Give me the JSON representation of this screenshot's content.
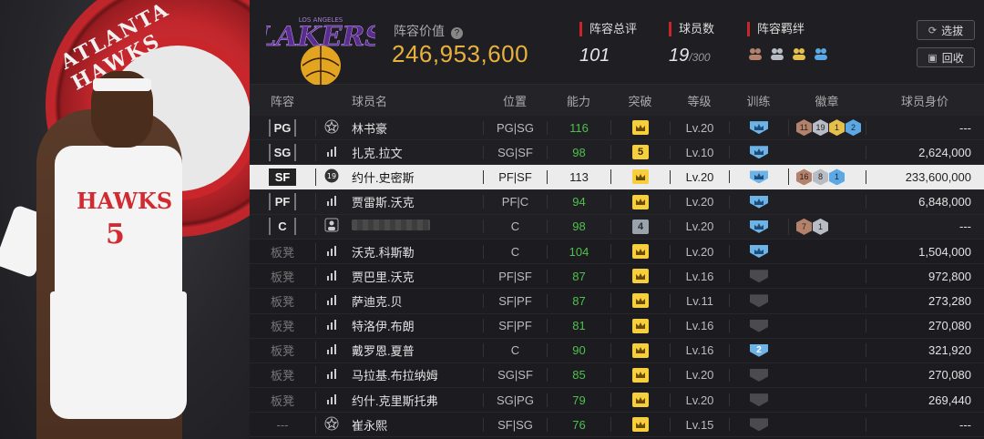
{
  "header": {
    "value_label": "阵容价值",
    "value": "246,953,600",
    "team_logo_text": "LAKERS",
    "team_logo_city": "LOS ANGELES",
    "stats": [
      {
        "label": "阵容总评",
        "value": "101"
      },
      {
        "label": "球员数",
        "value": "19",
        "suffix": "/300"
      },
      {
        "label": "阵容羁绊"
      }
    ],
    "buttons": {
      "pick": "选拔",
      "recycle": "回收"
    }
  },
  "left_panel": {
    "logo_text": "ATLANTA HAWKS",
    "jersey_name": "HAWKS",
    "jersey_number": "5"
  },
  "columns": {
    "lineup": "阵容",
    "player_name": "球员名",
    "position": "位置",
    "ability": "能力",
    "breakthrough": "突破",
    "level": "等级",
    "training": "训练",
    "badge": "徽章",
    "value": "球员身价"
  },
  "rows": [
    {
      "slot": "PG",
      "name": "林书豪",
      "position": "PG|SG",
      "ability": "116",
      "breakthrough": "crown",
      "level": "Lv.20",
      "training": "blue",
      "badges": [
        {
          "t": "bronze",
          "n": "11"
        },
        {
          "t": "silver",
          "n": "19"
        },
        {
          "t": "gold",
          "n": "1"
        },
        {
          "t": "blue",
          "n": "2"
        }
      ],
      "value": "---",
      "icon": "star"
    },
    {
      "slot": "SG",
      "name": "扎克.拉文",
      "position": "SG|SF",
      "ability": "98",
      "breakthrough": "5",
      "level": "Lv.10",
      "training": "blue",
      "badges": [],
      "value": "2,624,000",
      "icon": "bars"
    },
    {
      "slot": "SF",
      "name": "约什.史密斯",
      "position": "PF|SF",
      "ability": "113",
      "breakthrough": "crown",
      "level": "Lv.20",
      "training": "blue",
      "badges": [
        {
          "t": "bronze",
          "n": "16"
        },
        {
          "t": "silver",
          "n": "8"
        },
        {
          "t": "blue",
          "n": "1"
        }
      ],
      "value": "233,600,000",
      "icon": "rank19",
      "selected": true
    },
    {
      "slot": "PF",
      "name": "贾雷斯.沃克",
      "position": "PF|C",
      "ability": "94",
      "breakthrough": "crown",
      "level": "Lv.20",
      "training": "blue",
      "badges": [],
      "value": "6,848,000",
      "icon": "bars"
    },
    {
      "slot": "C",
      "name": "",
      "position": "C",
      "ability": "98",
      "breakthrough": "4",
      "level": "Lv.20",
      "training": "blue",
      "badges": [
        {
          "t": "bronze",
          "n": "7"
        },
        {
          "t": "silver",
          "n": "1"
        }
      ],
      "value": "---",
      "icon": "person",
      "blurred": true
    },
    {
      "slot": "板凳",
      "name": "沃克.科斯勒",
      "position": "C",
      "ability": "104",
      "breakthrough": "crown",
      "level": "Lv.20",
      "training": "blue",
      "badges": [],
      "value": "1,504,000",
      "icon": "bars"
    },
    {
      "slot": "板凳",
      "name": "贾巴里.沃克",
      "position": "PF|SF",
      "ability": "87",
      "breakthrough": "crown",
      "level": "Lv.16",
      "training": "grey",
      "badges": [],
      "value": "972,800",
      "icon": "bars"
    },
    {
      "slot": "板凳",
      "name": "萨迪克.贝",
      "position": "SF|PF",
      "ability": "87",
      "breakthrough": "crown",
      "level": "Lv.11",
      "training": "grey",
      "badges": [],
      "value": "273,280",
      "icon": "bars"
    },
    {
      "slot": "板凳",
      "name": "特洛伊.布朗",
      "position": "SF|PF",
      "ability": "81",
      "breakthrough": "crown",
      "level": "Lv.16",
      "training": "grey",
      "badges": [],
      "value": "270,080",
      "icon": "bars"
    },
    {
      "slot": "板凳",
      "name": "戴罗恩.夏普",
      "position": "C",
      "ability": "90",
      "breakthrough": "crown",
      "level": "Lv.16",
      "training": "blue2",
      "badges": [],
      "value": "321,920",
      "icon": "bars"
    },
    {
      "slot": "板凳",
      "name": "马拉基.布拉纳姆",
      "position": "SG|SF",
      "ability": "85",
      "breakthrough": "crown",
      "level": "Lv.20",
      "training": "grey",
      "badges": [],
      "value": "270,080",
      "icon": "bars"
    },
    {
      "slot": "板凳",
      "name": "约什.克里斯托弗",
      "position": "SG|PG",
      "ability": "79",
      "breakthrough": "crown",
      "level": "Lv.20",
      "training": "grey",
      "badges": [],
      "value": "269,440",
      "icon": "bars"
    },
    {
      "slot": "---",
      "name": "崔永熙",
      "position": "SF|SG",
      "ability": "76",
      "breakthrough": "crown",
      "level": "Lv.15",
      "training": "grey",
      "badges": [],
      "value": "---",
      "icon": "star"
    }
  ]
}
